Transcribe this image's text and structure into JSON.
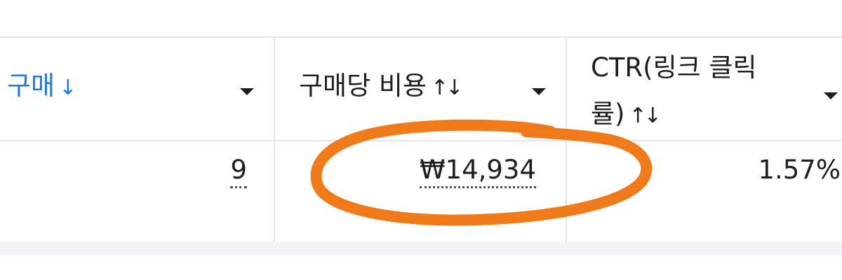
{
  "columns": [
    {
      "label": "구매",
      "sort_icon": "↓",
      "sorted": true,
      "active_color": "#1877f2"
    },
    {
      "label": "구매당 비용",
      "sort_icon": "↑↓",
      "sorted": false
    },
    {
      "label_line1": "CTR(링크 클릭",
      "label_line2": "률)",
      "sort_icon": "↑↓",
      "sorted": false
    }
  ],
  "row": {
    "purchases": "9",
    "cost_per_purchase": "₩14,934",
    "ctr": "1.57%"
  },
  "annotation": {
    "type": "hand-drawn-circle",
    "color": "#f07a1a",
    "target": "cost_per_purchase"
  },
  "icons": {
    "dropdown": "caret-down-icon",
    "sort_desc": "arrow-down-icon",
    "sort_both": "sort-updown-icon"
  }
}
